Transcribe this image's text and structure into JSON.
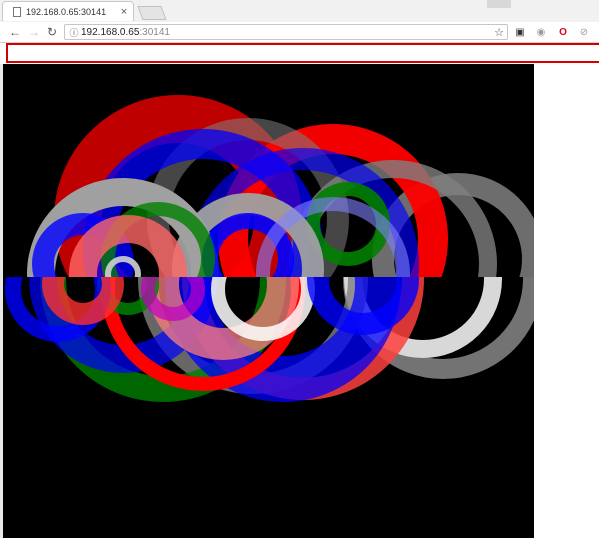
{
  "browser": {
    "tab": {
      "title": "192.168.0.65:30141",
      "close": "×"
    },
    "nav": {
      "back": "←",
      "forward": "→",
      "reload": "↻"
    },
    "omnibox": {
      "info_icon": "ⓘ",
      "host": "192.168.0.65",
      "port": ":30141",
      "bookmark_icon": "☆"
    },
    "extensions": [
      {
        "name": "meeting-icon",
        "glyph": "▣",
        "color": "#333333"
      },
      {
        "name": "database-icon",
        "glyph": "◉",
        "color": "#9a9a9a"
      },
      {
        "name": "opera-icon",
        "glyph": "O",
        "color": "#e3001b"
      },
      {
        "name": "blocked-icon",
        "glyph": "⊘",
        "color": "#9a9a9a"
      }
    ]
  },
  "input_bar": {
    "value": "",
    "border_color": "#d40000"
  },
  "canvas": {
    "background": "#000000",
    "fill_colors": [
      "#ff0000",
      "#0000ff",
      "#008000",
      "#808080",
      "#ffffff"
    ]
  }
}
